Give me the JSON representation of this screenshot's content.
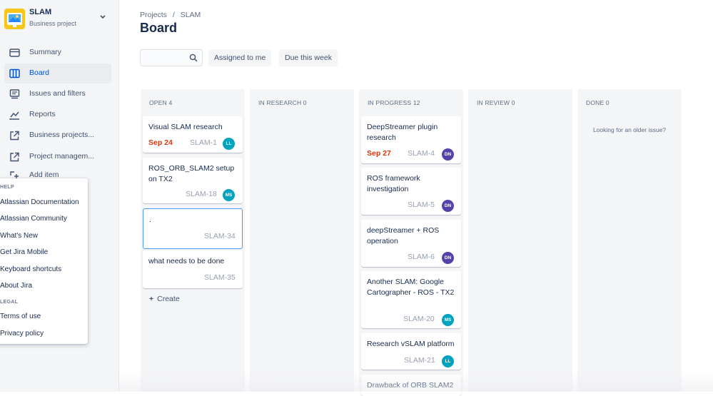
{
  "project": {
    "name": "SLAM",
    "type": "Business project"
  },
  "nav": [
    {
      "label": "Summary",
      "icon": "summary-icon"
    },
    {
      "label": "Board",
      "icon": "board-icon",
      "active": true
    },
    {
      "label": "Issues and filters",
      "icon": "issues-icon"
    },
    {
      "label": "Reports",
      "icon": "reports-icon"
    },
    {
      "label": "Business projects...",
      "icon": "external-link-icon"
    },
    {
      "label": "Project managem...",
      "icon": "external-link-icon"
    },
    {
      "label": "Add item",
      "icon": "add-item-icon"
    }
  ],
  "help_menu": {
    "help_heading": "HELP",
    "help_items": [
      "Atlassian Documentation",
      "Atlassian Community",
      "What's New",
      "Get Jira Mobile",
      "Keyboard shortcuts",
      "About Jira"
    ],
    "legal_heading": "LEGAL",
    "legal_items": [
      "Terms of use",
      "Privacy policy"
    ]
  },
  "breadcrumb": {
    "root": "Projects",
    "sep": "/",
    "current": "SLAM"
  },
  "page_title": "Board",
  "search": {
    "placeholder": ""
  },
  "filters": [
    "Assigned to me",
    "Due this week"
  ],
  "columns": [
    {
      "name": "OPEN",
      "count": "4",
      "cards": [
        {
          "title": "Visual SLAM research",
          "date": "Sep 24",
          "key": "SLAM-1",
          "assignee": "LL"
        },
        {
          "title": "ROS_ORB_SLAM2 setup on TX2",
          "key": "SLAM-18",
          "assignee": "MS"
        },
        {
          "title": ".",
          "key": "SLAM-34"
        },
        {
          "title": "what needs to be done",
          "key": "SLAM-35"
        }
      ],
      "create_label": "Create"
    },
    {
      "name": "IN RESEARCH",
      "count": "0",
      "cards": []
    },
    {
      "name": "IN PROGRESS",
      "count": "12",
      "cards": [
        {
          "title": "DeepStreamer plugin research",
          "date": "Sep 27",
          "key": "SLAM-4",
          "assignee": "DN"
        },
        {
          "title": "ROS framework investigation",
          "key": "SLAM-5",
          "assignee": "DN"
        },
        {
          "title": "deepStreamer + ROS operation",
          "key": "SLAM-6",
          "assignee": "DN"
        },
        {
          "title": "Another SLAM: Google Cartographer - ROS - TX2",
          "key": "SLAM-20",
          "assignee": "MS"
        },
        {
          "title": "Research vSLAM platform",
          "key": "SLAM-21",
          "assignee": "LL"
        },
        {
          "title": "Drawback of ORB SLAM2"
        }
      ]
    },
    {
      "name": "IN REVIEW",
      "count": "0",
      "cards": []
    },
    {
      "name": "DONE",
      "count": "0",
      "cards": [],
      "older_text": "Looking for an older issue?"
    }
  ],
  "colors": {
    "accent": "#0052CC",
    "due": "#DE350B",
    "avatar_LL": "#00A3BF",
    "avatar_MS": "#00A3BF",
    "avatar_DN": "#5243AA",
    "logo": "#F8C51B"
  }
}
